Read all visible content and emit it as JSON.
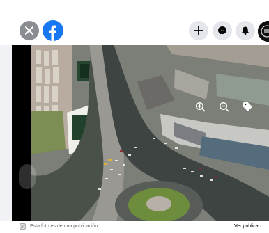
{
  "topbar": {
    "icons": [
      "close-icon",
      "facebook-logo",
      "plus-icon",
      "messenger-icon",
      "bell-icon",
      "avatar"
    ]
  },
  "viewer": {
    "photo_kind": "aerial city roundabout",
    "toolbar_icons": [
      "zoom-in-icon",
      "zoom-out-icon",
      "tag-icon"
    ]
  },
  "footer": {
    "caption": "Esta foto es de una publicación.",
    "view_post_label": "Ver publicac"
  },
  "colors": {
    "brand": "#1877f2",
    "button_gray": "#e4e6eb",
    "close_gray": "#8a8d91",
    "text_secondary": "#65676b"
  }
}
